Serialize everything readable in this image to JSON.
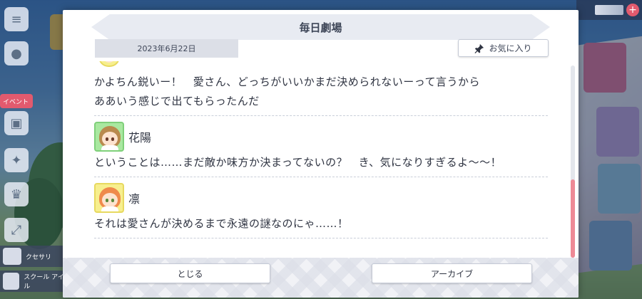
{
  "modal": {
    "title": "毎日劇場",
    "date": "2023年6月22日",
    "favorite_label": "お気に入り",
    "close_label": "とじる",
    "archive_label": "アーカイブ"
  },
  "dialogue": [
    {
      "speaker": "",
      "lines": [
        "かよちん鋭いー！　愛さん、どっちがいいかまだ決められないーって言うから",
        "ああいう感じで出てもらったんだ"
      ]
    },
    {
      "speaker": "花陽",
      "lines": [
        "ということは……まだ敵か味方か決まってないの？　き、気になりすぎるよ〜〜！"
      ]
    },
    {
      "speaker": "凛",
      "lines": [
        "それは愛さんが決めるまで永遠の謎なのにゃ……！"
      ]
    }
  ],
  "side_menu": {
    "labels": [
      "イベント",
      "クセサリ",
      "スクール アイドル"
    ],
    "icons": [
      "menu-icon",
      "chat-icon",
      "present-icon",
      "friends-icon",
      "trophy-icon",
      "expand-icon"
    ]
  },
  "colors": {
    "scroll_thumb": "#ee8a96",
    "title_band": "#e8ebf2",
    "date_chip": "#dcdfe7"
  }
}
